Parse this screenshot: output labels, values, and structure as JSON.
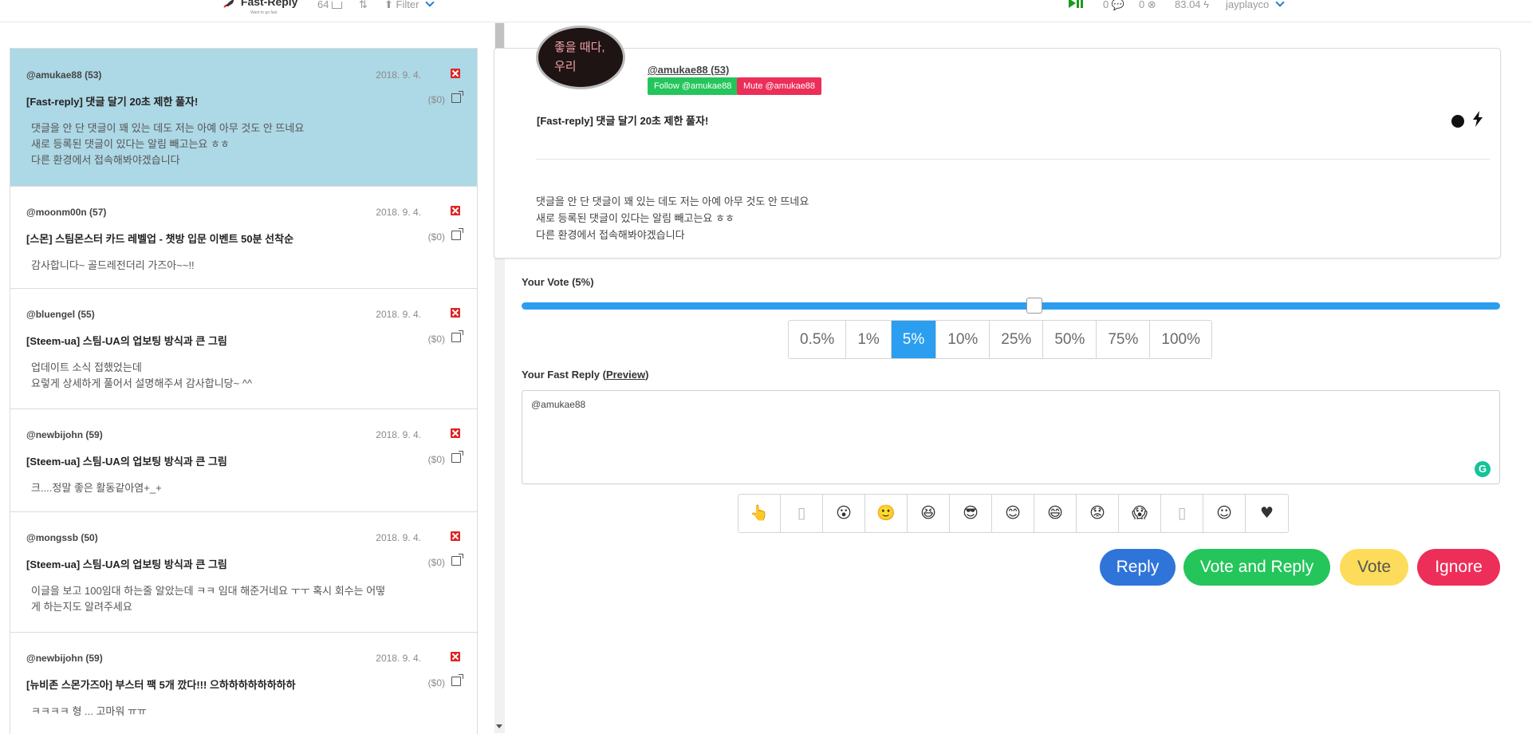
{
  "topbar": {
    "logo": "Fast-Reply",
    "logo_tagline": "Want to go fast",
    "inbox_count": "64",
    "filter_label": "Filter",
    "stat_a": "0",
    "stat_b": "0",
    "power": "83.04",
    "username": "jayplayco"
  },
  "comments": [
    {
      "author": "@amukae88 (53)",
      "date": "2018. 9. 4.",
      "title": "[Fast-reply] 댓글 달기 20초 제한 풀자!",
      "price": "($0)",
      "body": [
        "댓글을 안 단 댓글이 꽤 있는 데도 저는 아예 아무 것도 안 뜨네요",
        "새로 등록된 댓글이 있다는 알림 빼고는요 ㅎㅎ",
        "다른 환경에서 접속해봐야겠습니다"
      ],
      "active": true
    },
    {
      "author": "@moonm00n (57)",
      "date": "2018. 9. 4.",
      "title": "[스몬] 스팀몬스터 카드 레벨업 - 챗방 입문 이벤트 50분 선착순",
      "price": "($0)",
      "body": [
        "감사합니다~ 골드레전더리 가즈아~~!!"
      ],
      "active": false
    },
    {
      "author": "@bluengel (55)",
      "date": "2018. 9. 4.",
      "title": "[Steem-ua] 스팀-UA의 업보팅 방식과 큰 그림",
      "price": "($0)",
      "body": [
        "업데이트 소식 접했었는데",
        "요렇게 상세하게 풀어서 설명해주셔 감사합니당~ ^^"
      ],
      "active": false
    },
    {
      "author": "@newbijohn (59)",
      "date": "2018. 9. 4.",
      "title": "[Steem-ua] 스팀-UA의 업보팅 방식과 큰 그림",
      "price": "($0)",
      "body": [
        "크....정말 좋은 활동같아염+_+"
      ],
      "active": false
    },
    {
      "author": "@mongssb (50)",
      "date": "2018. 9. 4.",
      "title": "[Steem-ua] 스팀-UA의 업보팅 방식과 큰 그림",
      "price": "($0)",
      "body": [
        "이글을 보고 100임대 하는줄 알았는데 ㅋㅋ 임대 해준거네요 ㅜㅜ 혹시 회수는 어떻",
        "게 하는지도 알려주세요"
      ],
      "active": false
    },
    {
      "author": "@newbijohn (59)",
      "date": "2018. 9. 4.",
      "title": "[뉴비존 스몬가즈아] 부스터 팩 5개 깠다!!! 으하하하하하하하하",
      "price": "($0)",
      "body": [
        "ㅋㅋㅋㅋ 형 ... 고마워 ㅠㅠ"
      ],
      "active": false
    }
  ],
  "post": {
    "avatar_line1": "좋을 때다,",
    "avatar_line2": "우리",
    "author": "@amukae88 (53)",
    "follow_label": "Follow @amukae88",
    "mute_label": "Mute @amukae88",
    "title": "[Fast-reply] 댓글 달기 20초 제한 풀자!",
    "body": [
      "댓글을 안 단 댓글이 꽤 있는 데도 저는 아예 아무 것도 안 뜨네요",
      "새로 등록된 댓글이 있다는 알림 빼고는요 ㅎㅎ",
      "다른 환경에서 접속해봐야겠습니다"
    ]
  },
  "vote": {
    "label": "Your Vote (5%)",
    "value_percent": 5,
    "options": [
      "0.5%",
      "1%",
      "5%",
      "10%",
      "25%",
      "50%",
      "75%",
      "100%"
    ],
    "selected": "5%"
  },
  "reply": {
    "label_prefix": "Your Fast Reply (",
    "preview_label": "Preview",
    "label_suffix": ")",
    "text": "@amukae88",
    "emojis": [
      {
        "name": "pointer-hand-icon",
        "glyph": "👆"
      },
      {
        "name": "blank-emoji-icon",
        "glyph": "▯"
      },
      {
        "name": "surprised-face-icon",
        "glyph": "😮"
      },
      {
        "name": "smiling-face-icon",
        "glyph": "🙂"
      },
      {
        "name": "laughing-face-icon",
        "glyph": "😆"
      },
      {
        "name": "sunglasses-face-icon",
        "glyph": "😎"
      },
      {
        "name": "smile-face-icon",
        "glyph": "😊"
      },
      {
        "name": "grin-face-icon",
        "glyph": "😄"
      },
      {
        "name": "worried-face-icon",
        "glyph": "😟"
      },
      {
        "name": "scream-face-icon",
        "glyph": "😱"
      },
      {
        "name": "blank-emoji-icon-2",
        "glyph": "▯"
      },
      {
        "name": "slight-smile-face-icon",
        "glyph": "☺"
      },
      {
        "name": "heart-icon",
        "glyph": "♥"
      }
    ]
  },
  "actions": {
    "reply": "Reply",
    "vote_and_reply": "Vote and Reply",
    "vote": "Vote",
    "ignore": "Ignore"
  },
  "colors": {
    "active_row": "#add8e6",
    "vote_blue": "#2b9ef0",
    "reply_blue": "#2f74d9",
    "green": "#24c55a",
    "yellow": "#fddc5c",
    "red": "#ec2e59"
  }
}
